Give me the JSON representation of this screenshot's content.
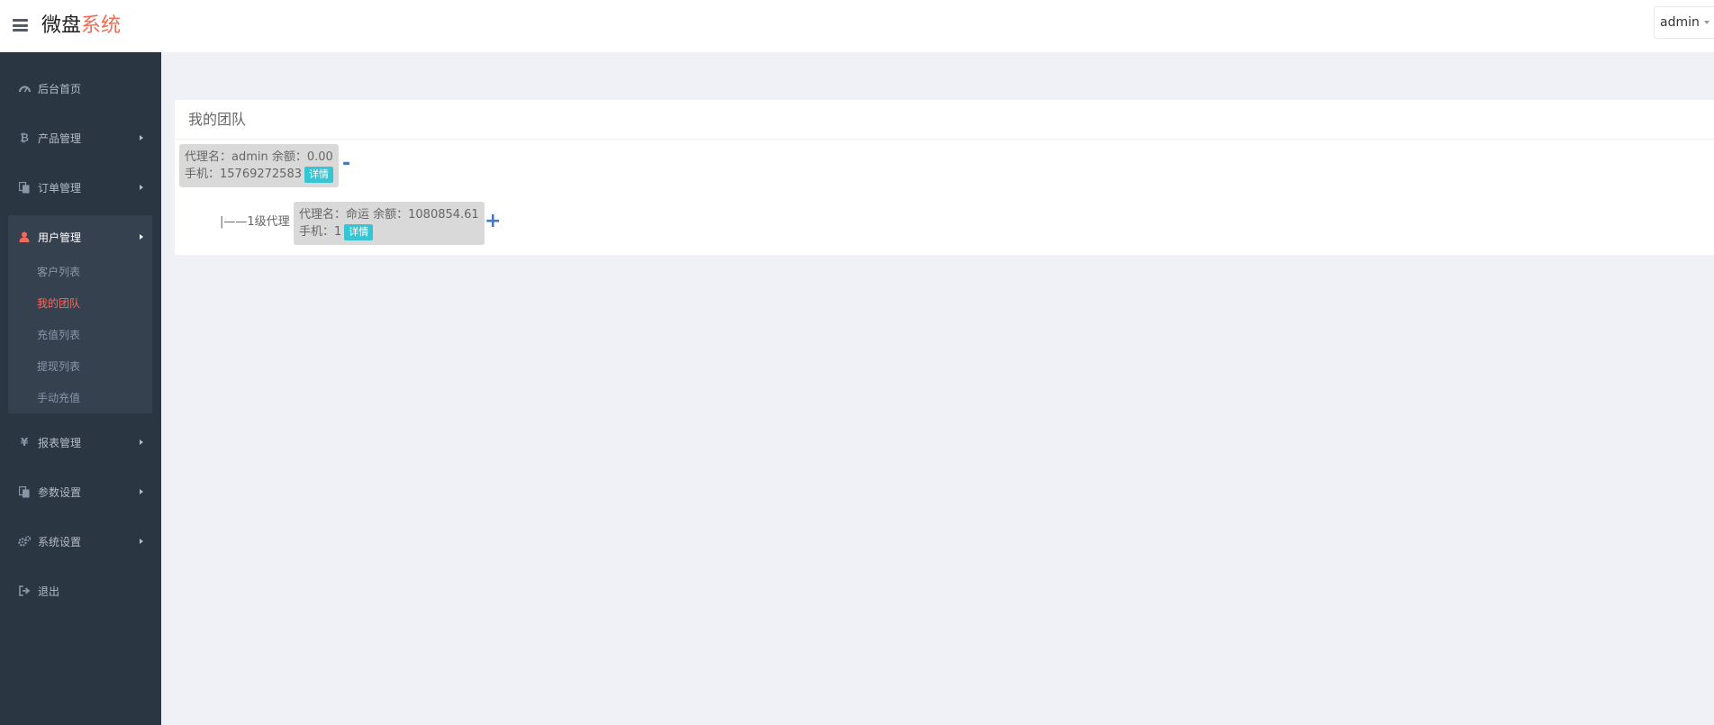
{
  "header": {
    "brand_main": "微盘",
    "brand_accent": "系统",
    "user": "admin"
  },
  "sidebar": {
    "items": [
      {
        "label": "后台首页",
        "icon": "dashboard-icon"
      },
      {
        "label": "产品管理",
        "icon": "bitcoin-icon"
      },
      {
        "label": "订单管理",
        "icon": "copy-icon"
      },
      {
        "label": "用户管理",
        "icon": "user-icon"
      },
      {
        "label": "报表管理",
        "icon": "yen-icon"
      },
      {
        "label": "参数设置",
        "icon": "copy-icon"
      },
      {
        "label": "系统设置",
        "icon": "cogs-icon"
      },
      {
        "label": "退出",
        "icon": "sign-out-icon"
      }
    ],
    "submenu": [
      {
        "label": "客户列表"
      },
      {
        "label": "我的团队"
      },
      {
        "label": "充值列表"
      },
      {
        "label": "提现列表"
      },
      {
        "label": "手动充值"
      }
    ]
  },
  "panel": {
    "title": "我的团队",
    "root": {
      "name_line": "代理名：admin 余额：0.00",
      "phone_line": "手机：15769272583",
      "detail": "详情",
      "toggle": "-"
    },
    "child": {
      "level": "|——1级代理",
      "name_line": "代理名：命运 余额：1080854.61",
      "phone_line": "手机：1",
      "detail": "详情",
      "toggle": "+"
    }
  },
  "colors": {
    "sidebar_bg": "#2b3643",
    "accent": "#f36a5a",
    "detail_button": "#36c6d3",
    "page_bg": "#eff1f6"
  }
}
